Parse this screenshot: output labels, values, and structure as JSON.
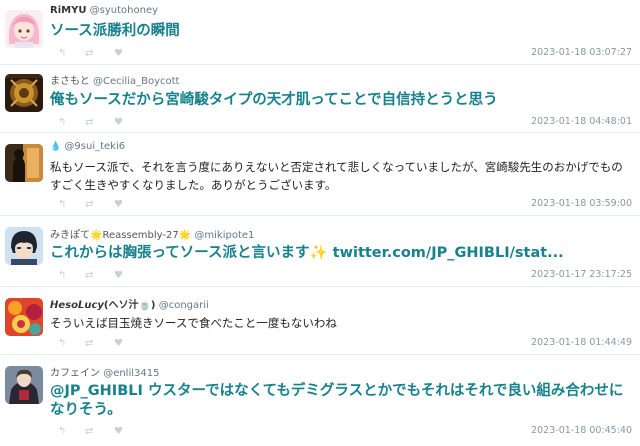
{
  "tweets": [
    {
      "name": "RiMYU",
      "handle": "@syutohoney",
      "text": "ソース派勝利の瞬間",
      "date": "2023-01-18 03:07:27",
      "avatar": "pink-haired anime girl"
    },
    {
      "name": "まさもと",
      "handle": "@Cecilia_Boycott",
      "text": "俺もソースだから宮崎駿タイプの天才肌ってことで自信持とうと思う",
      "date": "2023-01-18 04:48:01",
      "avatar": "ornate gold emblem"
    },
    {
      "name": "💧",
      "handle": "@9sui_teki6",
      "text": "私もソース派で、それを言う度にありえないと否定されて悲しくなっていましたが、宮崎駿先生のおかげでものすごく生きやすくなりました。ありがとうございます。",
      "date": "2023-01-18 03:59:00",
      "avatar": "silhouette at window"
    },
    {
      "name": "みきぽて🌟Reassembly-27🌟",
      "handle": "@mikipote1",
      "text": "これからは胸張ってソース派と言います✨ twitter.com/JP_GHIBLI/stat...",
      "date": "2023-01-17 23:17:25",
      "avatar": "anime boy with dark hair"
    },
    {
      "name": "𝙃𝙚𝙨𝙤𝙇𝙪𝙘𝙮(ヘソ汁🍵)",
      "handle": "@congarii",
      "text": "そういえば目玉焼きソースで食べたこと一度もないわね",
      "date": "2023-01-18 01:44:49",
      "avatar": "colorful red-orange artwork"
    },
    {
      "name": "カフェイン",
      "handle": "@enlil3415",
      "mention": "@JP_GHIBLI",
      "text": " ウスターではなくてもデミグラスとかでもそれはそれで良い組み合わせになりそう。",
      "date": "2023-01-18 00:45:40",
      "avatar": "anime character in dark outfit"
    }
  ],
  "icons": {
    "reply": "reply-icon",
    "retweet": "retweet-icon",
    "like": "heart-icon"
  },
  "colors": {
    "accent": "#17818c",
    "separator": "#e6ecf0",
    "date": "#8899a6"
  }
}
